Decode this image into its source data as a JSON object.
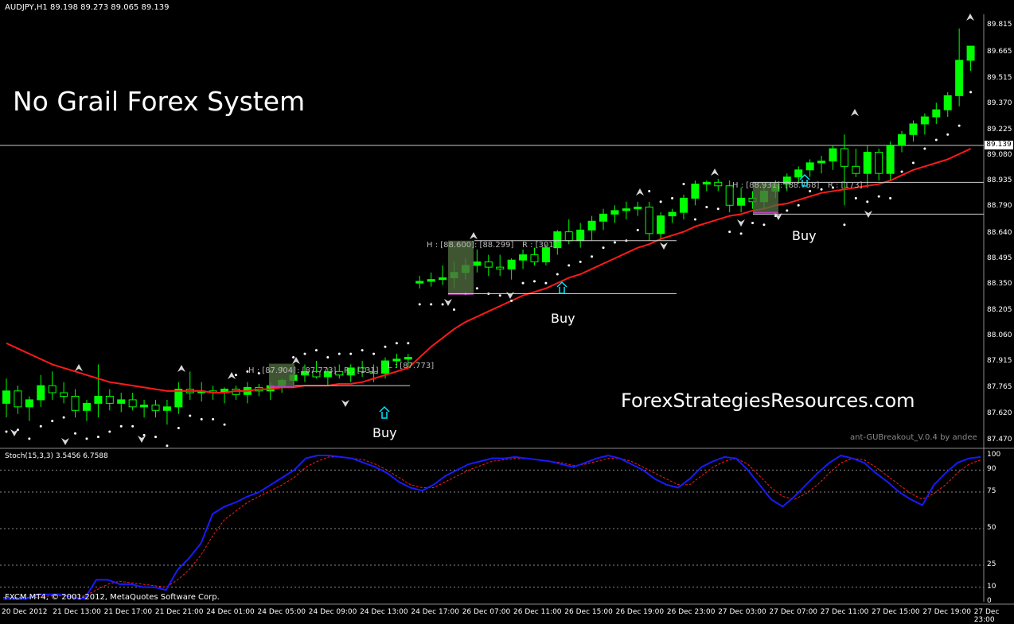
{
  "header": {
    "symbol_info": "AUDJPY,H1  89.198 89.273 89.065 89.139"
  },
  "title": "No Grail Forex System",
  "watermark": "ForexStrategiesResources.com",
  "indicator_tag": "ant-GUBreakout_V.0.4 by andee",
  "stoch_header": "Stoch(15,3,3) 3.5456 6.7588",
  "copyright": "FXCM MT4, © 2001-2012, MetaQuotes Software Corp.",
  "current_price": "89.139",
  "buy_label": "Buy",
  "breakouts": [
    {
      "h": "H : [87.904]",
      "l": ": [87.773]",
      "r": "R : [131]",
      "extra": "L : [87.773]"
    },
    {
      "h": "H : [88.600]",
      "l": ": [88.299]",
      "r": "R : [301]",
      "extra": ""
    },
    {
      "h": "H : [88.931]",
      "l": ": [88.758]",
      "r": "R : [173]",
      "extra": ""
    }
  ],
  "colors": {
    "background": "#000000",
    "bull": "#00ff00",
    "bear": "#000000",
    "ma": "#ff1a1a",
    "stoch_main": "#1a1aff",
    "stoch_signal": "#ff1a1a",
    "sar": "#ffffff",
    "box": "#4f6a3f",
    "arrow": "#00e5ff"
  },
  "chart_data": {
    "type": "candlestick",
    "y_ticks": [
      "89.815",
      "89.665",
      "89.515",
      "89.370",
      "89.225",
      "89.080",
      "88.935",
      "88.790",
      "88.640",
      "88.495",
      "88.350",
      "88.205",
      "88.060",
      "87.915",
      "87.765",
      "87.620",
      "87.470"
    ],
    "ylim": [
      87.43,
      89.88
    ],
    "x_ticks": [
      "20 Dec 2012",
      "21 Dec 13:00",
      "21 Dec 17:00",
      "21 Dec 21:00",
      "24 Dec 01:00",
      "24 Dec 05:00",
      "24 Dec 09:00",
      "24 Dec 13:00",
      "24 Dec 17:00",
      "26 Dec 07:00",
      "26 Dec 11:00",
      "26 Dec 15:00",
      "26 Dec 19:00",
      "26 Dec 23:00",
      "27 Dec 03:00",
      "27 Dec 07:00",
      "27 Dec 11:00",
      "27 Dec 15:00",
      "27 Dec 19:00",
      "27 Dec 23:00"
    ],
    "candles": [
      [
        87.68,
        87.82,
        87.6,
        87.75
      ],
      [
        87.75,
        87.78,
        87.62,
        87.66
      ],
      [
        87.66,
        87.72,
        87.58,
        87.7
      ],
      [
        87.7,
        87.84,
        87.66,
        87.78
      ],
      [
        87.78,
        87.86,
        87.7,
        87.74
      ],
      [
        87.74,
        87.8,
        87.68,
        87.72
      ],
      [
        87.72,
        87.76,
        87.6,
        87.64
      ],
      [
        87.64,
        87.7,
        87.58,
        87.68
      ],
      [
        87.68,
        87.9,
        87.6,
        87.72
      ],
      [
        87.72,
        87.76,
        87.64,
        87.68
      ],
      [
        87.68,
        87.74,
        87.63,
        87.7
      ],
      [
        87.7,
        87.74,
        87.64,
        87.66
      ],
      [
        87.66,
        87.7,
        87.6,
        87.67
      ],
      [
        87.67,
        87.7,
        87.6,
        87.64
      ],
      [
        87.64,
        87.7,
        87.56,
        87.66
      ],
      [
        87.66,
        87.8,
        87.62,
        87.76
      ],
      [
        87.76,
        87.86,
        87.7,
        87.74
      ],
      [
        87.74,
        87.8,
        87.69,
        87.75
      ],
      [
        87.75,
        87.78,
        87.7,
        87.74
      ],
      [
        87.74,
        87.77,
        87.68,
        87.76
      ],
      [
        87.76,
        87.78,
        87.7,
        87.73
      ],
      [
        87.73,
        87.8,
        87.68,
        87.77
      ],
      [
        87.77,
        87.79,
        87.72,
        87.75
      ],
      [
        87.75,
        87.8,
        87.7,
        87.78
      ],
      [
        87.78,
        87.82,
        87.74,
        87.81
      ],
      [
        87.81,
        87.88,
        87.77,
        87.84
      ],
      [
        87.84,
        87.9,
        87.8,
        87.86
      ],
      [
        87.86,
        87.92,
        87.82,
        87.83
      ],
      [
        87.83,
        87.88,
        87.78,
        87.86
      ],
      [
        87.86,
        87.9,
        87.82,
        87.84
      ],
      [
        87.84,
        87.9,
        87.8,
        87.88
      ],
      [
        87.88,
        87.92,
        87.83,
        87.86
      ],
      [
        87.86,
        87.9,
        87.8,
        87.85
      ],
      [
        87.85,
        87.94,
        87.82,
        87.92
      ],
      [
        87.92,
        87.96,
        87.88,
        87.93
      ],
      [
        87.93,
        87.96,
        87.88,
        87.94
      ],
      [
        88.36,
        88.4,
        88.33,
        88.37
      ],
      [
        88.37,
        88.42,
        88.34,
        88.38
      ],
      [
        88.38,
        88.46,
        88.35,
        88.39
      ],
      [
        88.39,
        88.48,
        88.33,
        88.42
      ],
      [
        88.42,
        88.5,
        88.38,
        88.46
      ],
      [
        88.46,
        88.55,
        88.42,
        88.48
      ],
      [
        88.48,
        88.52,
        88.4,
        88.45
      ],
      [
        88.45,
        88.52,
        88.4,
        88.44
      ],
      [
        88.44,
        88.5,
        88.38,
        88.49
      ],
      [
        88.49,
        88.55,
        88.44,
        88.52
      ],
      [
        88.52,
        88.56,
        88.46,
        88.48
      ],
      [
        88.48,
        88.58,
        88.46,
        88.56
      ],
      [
        88.56,
        88.66,
        88.52,
        88.65
      ],
      [
        88.65,
        88.72,
        88.58,
        88.6
      ],
      [
        88.6,
        88.7,
        88.56,
        88.66
      ],
      [
        88.66,
        88.74,
        88.6,
        88.71
      ],
      [
        88.71,
        88.78,
        88.66,
        88.75
      ],
      [
        88.75,
        88.8,
        88.7,
        88.77
      ],
      [
        88.77,
        88.82,
        88.72,
        88.78
      ],
      [
        88.78,
        88.82,
        88.74,
        88.79
      ],
      [
        88.79,
        88.82,
        88.6,
        88.64
      ],
      [
        88.64,
        88.76,
        88.6,
        88.74
      ],
      [
        88.74,
        88.78,
        88.7,
        88.76
      ],
      [
        88.76,
        88.86,
        88.72,
        88.84
      ],
      [
        88.84,
        88.94,
        88.8,
        88.92
      ],
      [
        88.92,
        88.94,
        88.88,
        88.93
      ],
      [
        88.93,
        88.95,
        88.88,
        88.91
      ],
      [
        88.91,
        88.94,
        88.76,
        88.8
      ],
      [
        88.8,
        88.9,
        88.76,
        88.84
      ],
      [
        88.84,
        88.88,
        88.78,
        88.82
      ],
      [
        88.82,
        88.92,
        88.78,
        88.88
      ],
      [
        88.88,
        88.94,
        88.84,
        88.92
      ],
      [
        88.92,
        88.98,
        88.88,
        88.96
      ],
      [
        88.96,
        89.02,
        88.92,
        89.0
      ],
      [
        89.0,
        89.06,
        88.96,
        89.04
      ],
      [
        89.04,
        89.08,
        88.98,
        89.05
      ],
      [
        89.05,
        89.14,
        89.0,
        89.12
      ],
      [
        89.12,
        89.2,
        88.8,
        89.02
      ],
      [
        89.02,
        89.12,
        88.96,
        88.98
      ],
      [
        88.98,
        89.14,
        88.9,
        89.1
      ],
      [
        89.1,
        89.12,
        88.94,
        88.98
      ],
      [
        88.98,
        89.16,
        88.94,
        89.14
      ],
      [
        89.14,
        89.22,
        89.1,
        89.2
      ],
      [
        89.2,
        89.28,
        89.16,
        89.26
      ],
      [
        89.26,
        89.32,
        89.2,
        89.3
      ],
      [
        89.3,
        89.38,
        89.26,
        89.34
      ],
      [
        89.34,
        89.44,
        89.3,
        89.42
      ],
      [
        89.42,
        89.8,
        89.36,
        89.62
      ],
      [
        89.62,
        89.7,
        89.56,
        89.7
      ]
    ],
    "ma": [
      88.02,
      87.99,
      87.96,
      87.93,
      87.9,
      87.88,
      87.86,
      87.84,
      87.82,
      87.8,
      87.79,
      87.78,
      87.77,
      87.76,
      87.75,
      87.75,
      87.75,
      87.75,
      87.74,
      87.74,
      87.75,
      87.75,
      87.76,
      87.76,
      87.77,
      87.77,
      87.78,
      87.78,
      87.78,
      87.79,
      87.79,
      87.8,
      87.82,
      87.84,
      87.86,
      87.88,
      87.94,
      88.0,
      88.05,
      88.1,
      88.14,
      88.17,
      88.2,
      88.23,
      88.26,
      88.29,
      88.31,
      88.33,
      88.36,
      88.39,
      88.41,
      88.44,
      88.47,
      88.5,
      88.53,
      88.56,
      88.58,
      88.61,
      88.63,
      88.65,
      88.68,
      88.7,
      88.72,
      88.74,
      88.75,
      88.77,
      88.78,
      88.8,
      88.81,
      88.83,
      88.85,
      88.87,
      88.88,
      88.89,
      88.9,
      88.91,
      88.92,
      88.94,
      88.97,
      89.0,
      89.02,
      89.04,
      89.06,
      89.09,
      89.12
    ],
    "stoch_main": [
      2,
      2,
      2,
      5,
      5,
      5,
      3,
      2,
      15,
      15,
      12,
      12,
      10,
      10,
      8,
      22,
      30,
      40,
      60,
      65,
      68,
      72,
      75,
      80,
      85,
      90,
      98,
      100,
      100,
      99,
      98,
      95,
      92,
      88,
      82,
      78,
      76,
      80,
      86,
      90,
      94,
      96,
      98,
      98,
      99,
      98,
      97,
      96,
      94,
      92,
      95,
      98,
      100,
      98,
      94,
      90,
      84,
      80,
      78,
      84,
      92,
      96,
      99,
      98,
      90,
      80,
      70,
      65,
      72,
      80,
      88,
      95,
      100,
      98,
      95,
      88,
      82,
      75,
      70,
      66,
      80,
      88,
      95,
      98,
      99
    ],
    "stoch_signal": [
      3,
      3,
      3,
      3,
      4,
      4,
      4,
      4,
      8,
      12,
      14,
      13,
      12,
      11,
      10,
      15,
      22,
      32,
      45,
      56,
      62,
      68,
      72,
      76,
      80,
      85,
      92,
      96,
      99,
      99,
      98,
      97,
      94,
      90,
      85,
      80,
      78,
      78,
      82,
      86,
      90,
      93,
      96,
      97,
      98,
      98,
      97,
      96,
      95,
      93,
      94,
      96,
      98,
      98,
      96,
      92,
      88,
      84,
      80,
      80,
      86,
      92,
      96,
      98,
      94,
      86,
      78,
      72,
      70,
      74,
      80,
      88,
      95,
      98,
      97,
      92,
      86,
      80,
      74,
      70,
      74,
      80,
      88,
      94,
      97
    ]
  }
}
